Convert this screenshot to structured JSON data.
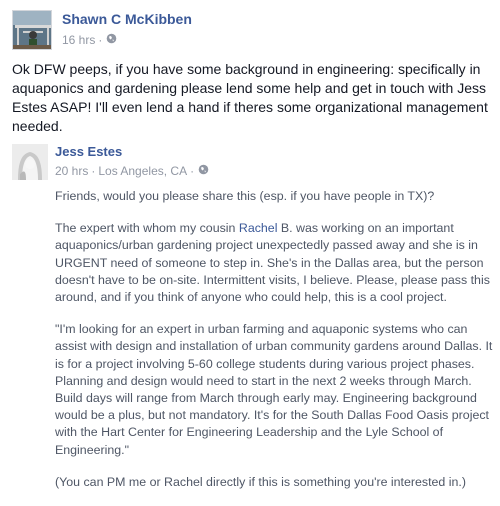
{
  "post": {
    "author": "Shawn C McKibben",
    "time": "16 hrs",
    "separator": "·",
    "privacy_icon": "globe-icon",
    "text": "Ok DFW peeps, if you have some background in engineering: specifically in aquaponics and gardening please lend some help and get in touch with Jess Estes ASAP! I'll even lend a hand if theres some organizational management needed."
  },
  "shared": {
    "author": "Jess Estes",
    "time": "20 hrs",
    "separator": "·",
    "location": "Los Angeles, CA",
    "privacy_icon": "globe-icon",
    "p1": "Friends, would you please share this (esp. if you have people in TX)?",
    "p2_before": "The expert with whom my cousin ",
    "p2_link": "Rachel",
    "p2_after": " B. was working on an important aquaponics/urban gardening project unexpectedly passed away and she is in URGENT need of someone to step in. She's in the Dallas area, but the person doesn't have to be on-site. Intermittent visits, I believe. Please, please pass this around, and if you think of anyone who could help, this is a cool project.",
    "p3": "\"I'm looking for an expert in urban farming and aquaponic systems who can assist with design and installation of urban community gardens around Dallas. It is for a project involving 5-60 college students during various project phases. Planning and design would need to start in the next 2 weeks through March. Build days will range from March through early may. Engineering background would be a plus, but not mandatory. It's for the South Dallas Food Oasis project with the Hart Center for Engineering Leadership and the Lyle School of Engineering.\"",
    "p4": "(You can PM me or Rachel directly if this is something you're interested in.)"
  }
}
